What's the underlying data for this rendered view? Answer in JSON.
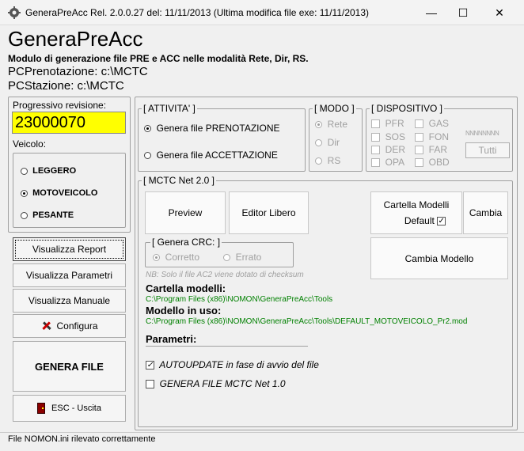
{
  "window": {
    "title": "GeneraPreAcc Rel. 2.0.0.27 del: 11/11/2013 (Ultima modifica file exe: 11/11/2013)",
    "minimize": "—",
    "maximize": "☐",
    "close": "✕"
  },
  "header": {
    "app_title": "GeneraPreAcc",
    "subtitle": "Modulo di generazione file PRE e ACC nelle modalità Rete, Dir, RS.",
    "pc_prenotazione": "PCPrenotazione: c:\\MCTC",
    "pc_stazione": "PCStazione: c:\\MCTC"
  },
  "left": {
    "progressivo_label": "Progressivo revisione:",
    "progressivo_value": "23000070",
    "veicolo_label": "Veicolo:",
    "veicolo_options": [
      "LEGGERO",
      "MOTOVEICOLO",
      "PESANTE"
    ],
    "buttons": {
      "report": "Visualizza Report",
      "parametri": "Visualizza Parametri",
      "manuale": "Visualizza Manuale",
      "configura": "Configura",
      "genera": "GENERA FILE",
      "esc": "ESC - Uscita"
    }
  },
  "attivita": {
    "legend": "[ ATTIVITA' ]",
    "options": [
      "Genera file PRENOTAZIONE",
      "Genera file ACCETTAZIONE"
    ]
  },
  "modo": {
    "legend": "[ MODO ]",
    "options": [
      "Rete",
      "Dir",
      "RS"
    ]
  },
  "dispositivo": {
    "legend": "[ DISPOSITIVO ]",
    "col1": [
      "PFR",
      "SOS",
      "DER",
      "OPA"
    ],
    "col2": [
      "GAS",
      "FON",
      "FAR",
      "OBD"
    ],
    "placeholder": "NNNNNNNN",
    "tutti": "Tutti"
  },
  "mctc": {
    "legend": "[ MCTC Net 2.0 ]",
    "preview": "Preview",
    "editor": "Editor Libero",
    "cartella_modelli": "Cartella Modelli",
    "default_label": "Default",
    "cambia": "Cambia",
    "cambia_modello": "Cambia Modello",
    "crc_legend": "[ Genera CRC: ]",
    "crc_options": [
      "Corretto",
      "Errato"
    ],
    "note": "NB: Solo il file AC2 viene dotato di checksum",
    "cartella_label": "Cartella modelli:",
    "cartella_path": "C:\\Program Files (x86)\\NOMON\\GeneraPreAcc\\Tools",
    "modello_label": "Modello in uso:",
    "modello_path": "C:\\Program Files (x86)\\NOMON\\GeneraPreAcc\\Tools\\DEFAULT_MOTOVEICOLO_Pr2.mod",
    "parametri_label": "Parametri:",
    "autoupdate": "AUTOUPDATE in fase di avvio del file",
    "genera_mctc": "GENERA FILE MCTC Net 1.0"
  },
  "status": {
    "text": "File NOMON.ini rilevato correttamente"
  }
}
